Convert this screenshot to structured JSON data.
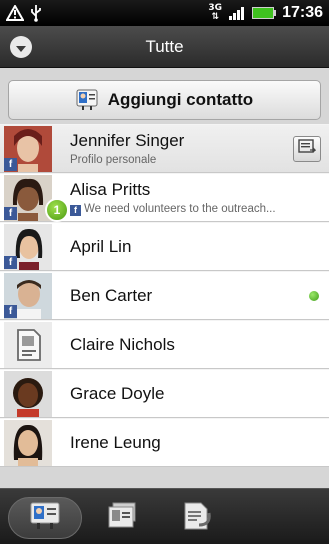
{
  "status": {
    "network": "3G",
    "time": "17:36"
  },
  "header": {
    "title": "Tutte"
  },
  "add_contact": {
    "label": "Aggiungi contatto"
  },
  "contacts": [
    {
      "name": "Jennifer Singer",
      "subtitle": "Profilo personale"
    },
    {
      "name": "Alisa Pritts",
      "subtitle": "We need volunteers to the outreach...",
      "badge": "1"
    },
    {
      "name": "April Lin"
    },
    {
      "name": "Ben Carter"
    },
    {
      "name": "Claire Nichols"
    },
    {
      "name": "Grace Doyle"
    },
    {
      "name": "Irene Leung"
    }
  ],
  "facebook_mark": "f",
  "tabs": [
    {
      "icon": "contacts-tab-icon"
    },
    {
      "icon": "groups-tab-icon"
    },
    {
      "icon": "call-history-tab-icon"
    }
  ]
}
